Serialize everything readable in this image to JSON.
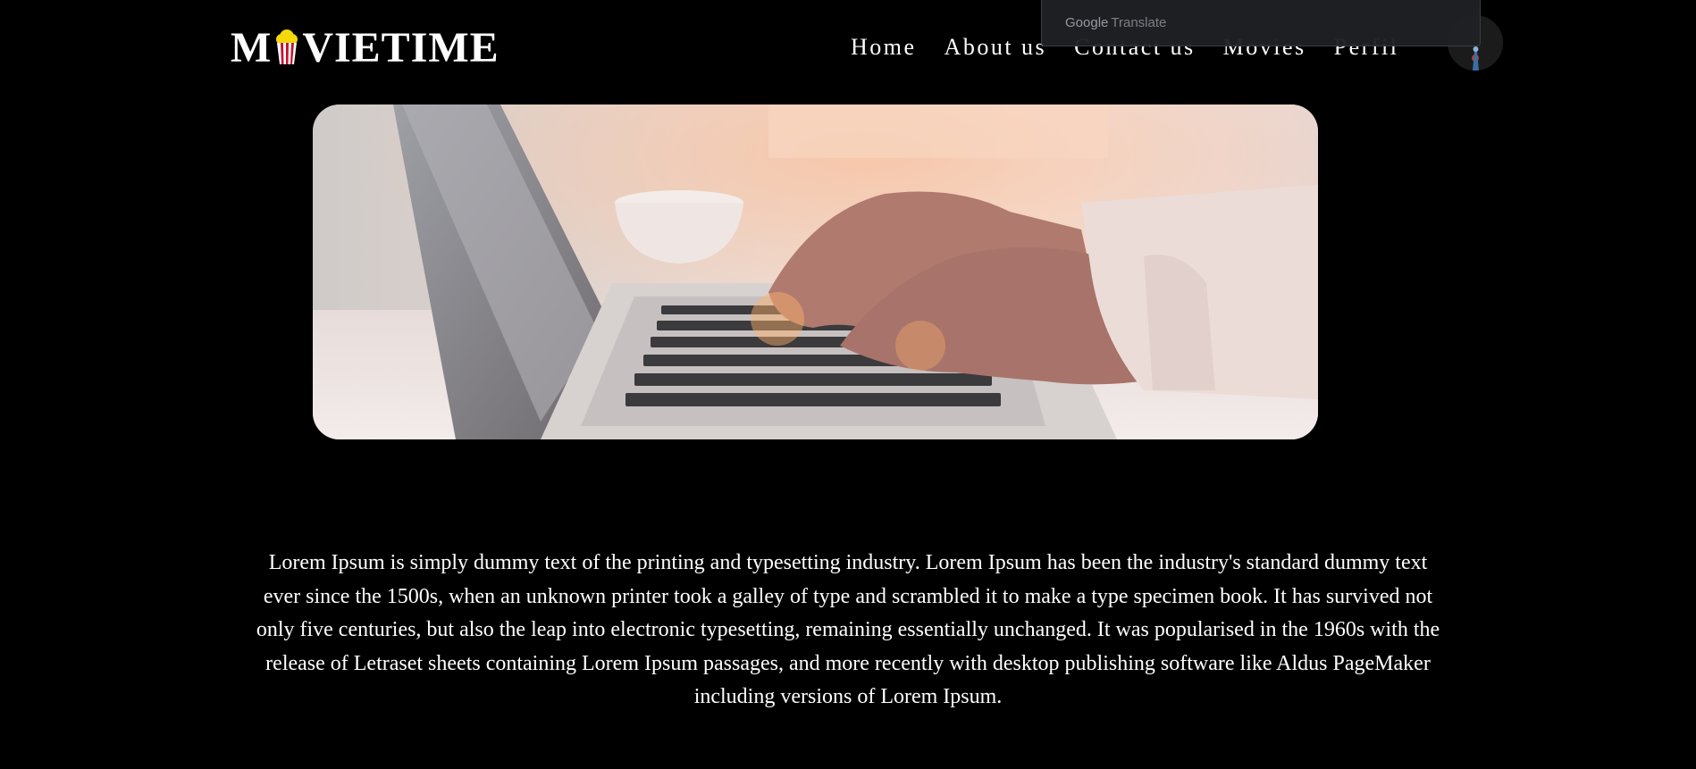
{
  "header": {
    "logo_before": "M",
    "logo_after": "VIETIME",
    "logo_icon": "popcorn-icon",
    "nav": [
      {
        "label": "Home"
      },
      {
        "label": "About us"
      },
      {
        "label": "Contact us"
      },
      {
        "label": "Movies"
      },
      {
        "label": "Perfil"
      }
    ],
    "avatar_icon": "user-avatar"
  },
  "translate_bar": {
    "google": "Google",
    "translate": "Translate"
  },
  "hero": {
    "image_icon": "laptop-typing-photo"
  },
  "content": {
    "paragraph": "Lorem Ipsum is simply dummy text of the printing and typesetting industry. Lorem Ipsum has been the industry's standard dummy text ever since the 1500s, when an unknown printer took a galley of type and scrambled it to make a type specimen book. It has survived not only five centuries, but also the leap into electronic typesetting, remaining essentially unchanged. It was popularised in the 1960s with the release of Letraset sheets containing Lorem Ipsum passages, and more recently with desktop publishing software like Aldus PageMaker including versions of Lorem Ipsum."
  },
  "colors": {
    "background": "#000000",
    "text": "#ffffff",
    "popcorn_yellow": "#f5d90a",
    "popcorn_red": "#c8102e"
  }
}
